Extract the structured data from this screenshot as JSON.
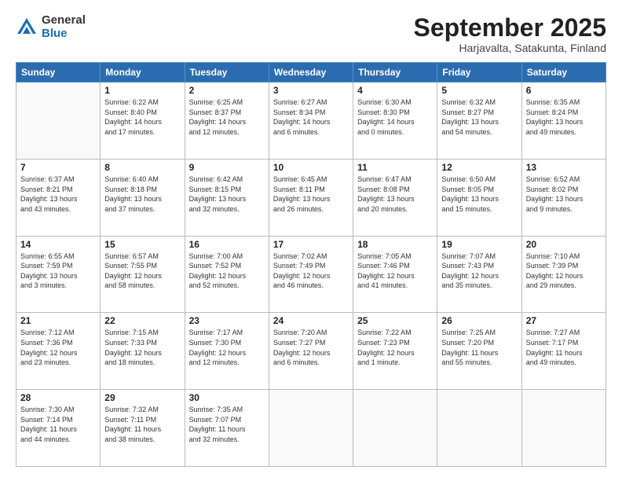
{
  "logo": {
    "general": "General",
    "blue": "Blue"
  },
  "header": {
    "title": "September 2025",
    "subtitle": "Harjavalta, Satakunta, Finland"
  },
  "weekdays": [
    "Sunday",
    "Monday",
    "Tuesday",
    "Wednesday",
    "Thursday",
    "Friday",
    "Saturday"
  ],
  "weeks": [
    [
      {
        "day": "",
        "info": ""
      },
      {
        "day": "1",
        "info": "Sunrise: 6:22 AM\nSunset: 8:40 PM\nDaylight: 14 hours\nand 17 minutes."
      },
      {
        "day": "2",
        "info": "Sunrise: 6:25 AM\nSunset: 8:37 PM\nDaylight: 14 hours\nand 12 minutes."
      },
      {
        "day": "3",
        "info": "Sunrise: 6:27 AM\nSunset: 8:34 PM\nDaylight: 14 hours\nand 6 minutes."
      },
      {
        "day": "4",
        "info": "Sunrise: 6:30 AM\nSunset: 8:30 PM\nDaylight: 14 hours\nand 0 minutes."
      },
      {
        "day": "5",
        "info": "Sunrise: 6:32 AM\nSunset: 8:27 PM\nDaylight: 13 hours\nand 54 minutes."
      },
      {
        "day": "6",
        "info": "Sunrise: 6:35 AM\nSunset: 8:24 PM\nDaylight: 13 hours\nand 49 minutes."
      }
    ],
    [
      {
        "day": "7",
        "info": "Sunrise: 6:37 AM\nSunset: 8:21 PM\nDaylight: 13 hours\nand 43 minutes."
      },
      {
        "day": "8",
        "info": "Sunrise: 6:40 AM\nSunset: 8:18 PM\nDaylight: 13 hours\nand 37 minutes."
      },
      {
        "day": "9",
        "info": "Sunrise: 6:42 AM\nSunset: 8:15 PM\nDaylight: 13 hours\nand 32 minutes."
      },
      {
        "day": "10",
        "info": "Sunrise: 6:45 AM\nSunset: 8:11 PM\nDaylight: 13 hours\nand 26 minutes."
      },
      {
        "day": "11",
        "info": "Sunrise: 6:47 AM\nSunset: 8:08 PM\nDaylight: 13 hours\nand 20 minutes."
      },
      {
        "day": "12",
        "info": "Sunrise: 6:50 AM\nSunset: 8:05 PM\nDaylight: 13 hours\nand 15 minutes."
      },
      {
        "day": "13",
        "info": "Sunrise: 6:52 AM\nSunset: 8:02 PM\nDaylight: 13 hours\nand 9 minutes."
      }
    ],
    [
      {
        "day": "14",
        "info": "Sunrise: 6:55 AM\nSunset: 7:59 PM\nDaylight: 13 hours\nand 3 minutes."
      },
      {
        "day": "15",
        "info": "Sunrise: 6:57 AM\nSunset: 7:55 PM\nDaylight: 12 hours\nand 58 minutes."
      },
      {
        "day": "16",
        "info": "Sunrise: 7:00 AM\nSunset: 7:52 PM\nDaylight: 12 hours\nand 52 minutes."
      },
      {
        "day": "17",
        "info": "Sunrise: 7:02 AM\nSunset: 7:49 PM\nDaylight: 12 hours\nand 46 minutes."
      },
      {
        "day": "18",
        "info": "Sunrise: 7:05 AM\nSunset: 7:46 PM\nDaylight: 12 hours\nand 41 minutes."
      },
      {
        "day": "19",
        "info": "Sunrise: 7:07 AM\nSunset: 7:43 PM\nDaylight: 12 hours\nand 35 minutes."
      },
      {
        "day": "20",
        "info": "Sunrise: 7:10 AM\nSunset: 7:39 PM\nDaylight: 12 hours\nand 29 minutes."
      }
    ],
    [
      {
        "day": "21",
        "info": "Sunrise: 7:12 AM\nSunset: 7:36 PM\nDaylight: 12 hours\nand 23 minutes."
      },
      {
        "day": "22",
        "info": "Sunrise: 7:15 AM\nSunset: 7:33 PM\nDaylight: 12 hours\nand 18 minutes."
      },
      {
        "day": "23",
        "info": "Sunrise: 7:17 AM\nSunset: 7:30 PM\nDaylight: 12 hours\nand 12 minutes."
      },
      {
        "day": "24",
        "info": "Sunrise: 7:20 AM\nSunset: 7:27 PM\nDaylight: 12 hours\nand 6 minutes."
      },
      {
        "day": "25",
        "info": "Sunrise: 7:22 AM\nSunset: 7:23 PM\nDaylight: 12 hours\nand 1 minute."
      },
      {
        "day": "26",
        "info": "Sunrise: 7:25 AM\nSunset: 7:20 PM\nDaylight: 11 hours\nand 55 minutes."
      },
      {
        "day": "27",
        "info": "Sunrise: 7:27 AM\nSunset: 7:17 PM\nDaylight: 11 hours\nand 49 minutes."
      }
    ],
    [
      {
        "day": "28",
        "info": "Sunrise: 7:30 AM\nSunset: 7:14 PM\nDaylight: 11 hours\nand 44 minutes."
      },
      {
        "day": "29",
        "info": "Sunrise: 7:32 AM\nSunset: 7:11 PM\nDaylight: 11 hours\nand 38 minutes."
      },
      {
        "day": "30",
        "info": "Sunrise: 7:35 AM\nSunset: 7:07 PM\nDaylight: 11 hours\nand 32 minutes."
      },
      {
        "day": "",
        "info": ""
      },
      {
        "day": "",
        "info": ""
      },
      {
        "day": "",
        "info": ""
      },
      {
        "day": "",
        "info": ""
      }
    ]
  ]
}
